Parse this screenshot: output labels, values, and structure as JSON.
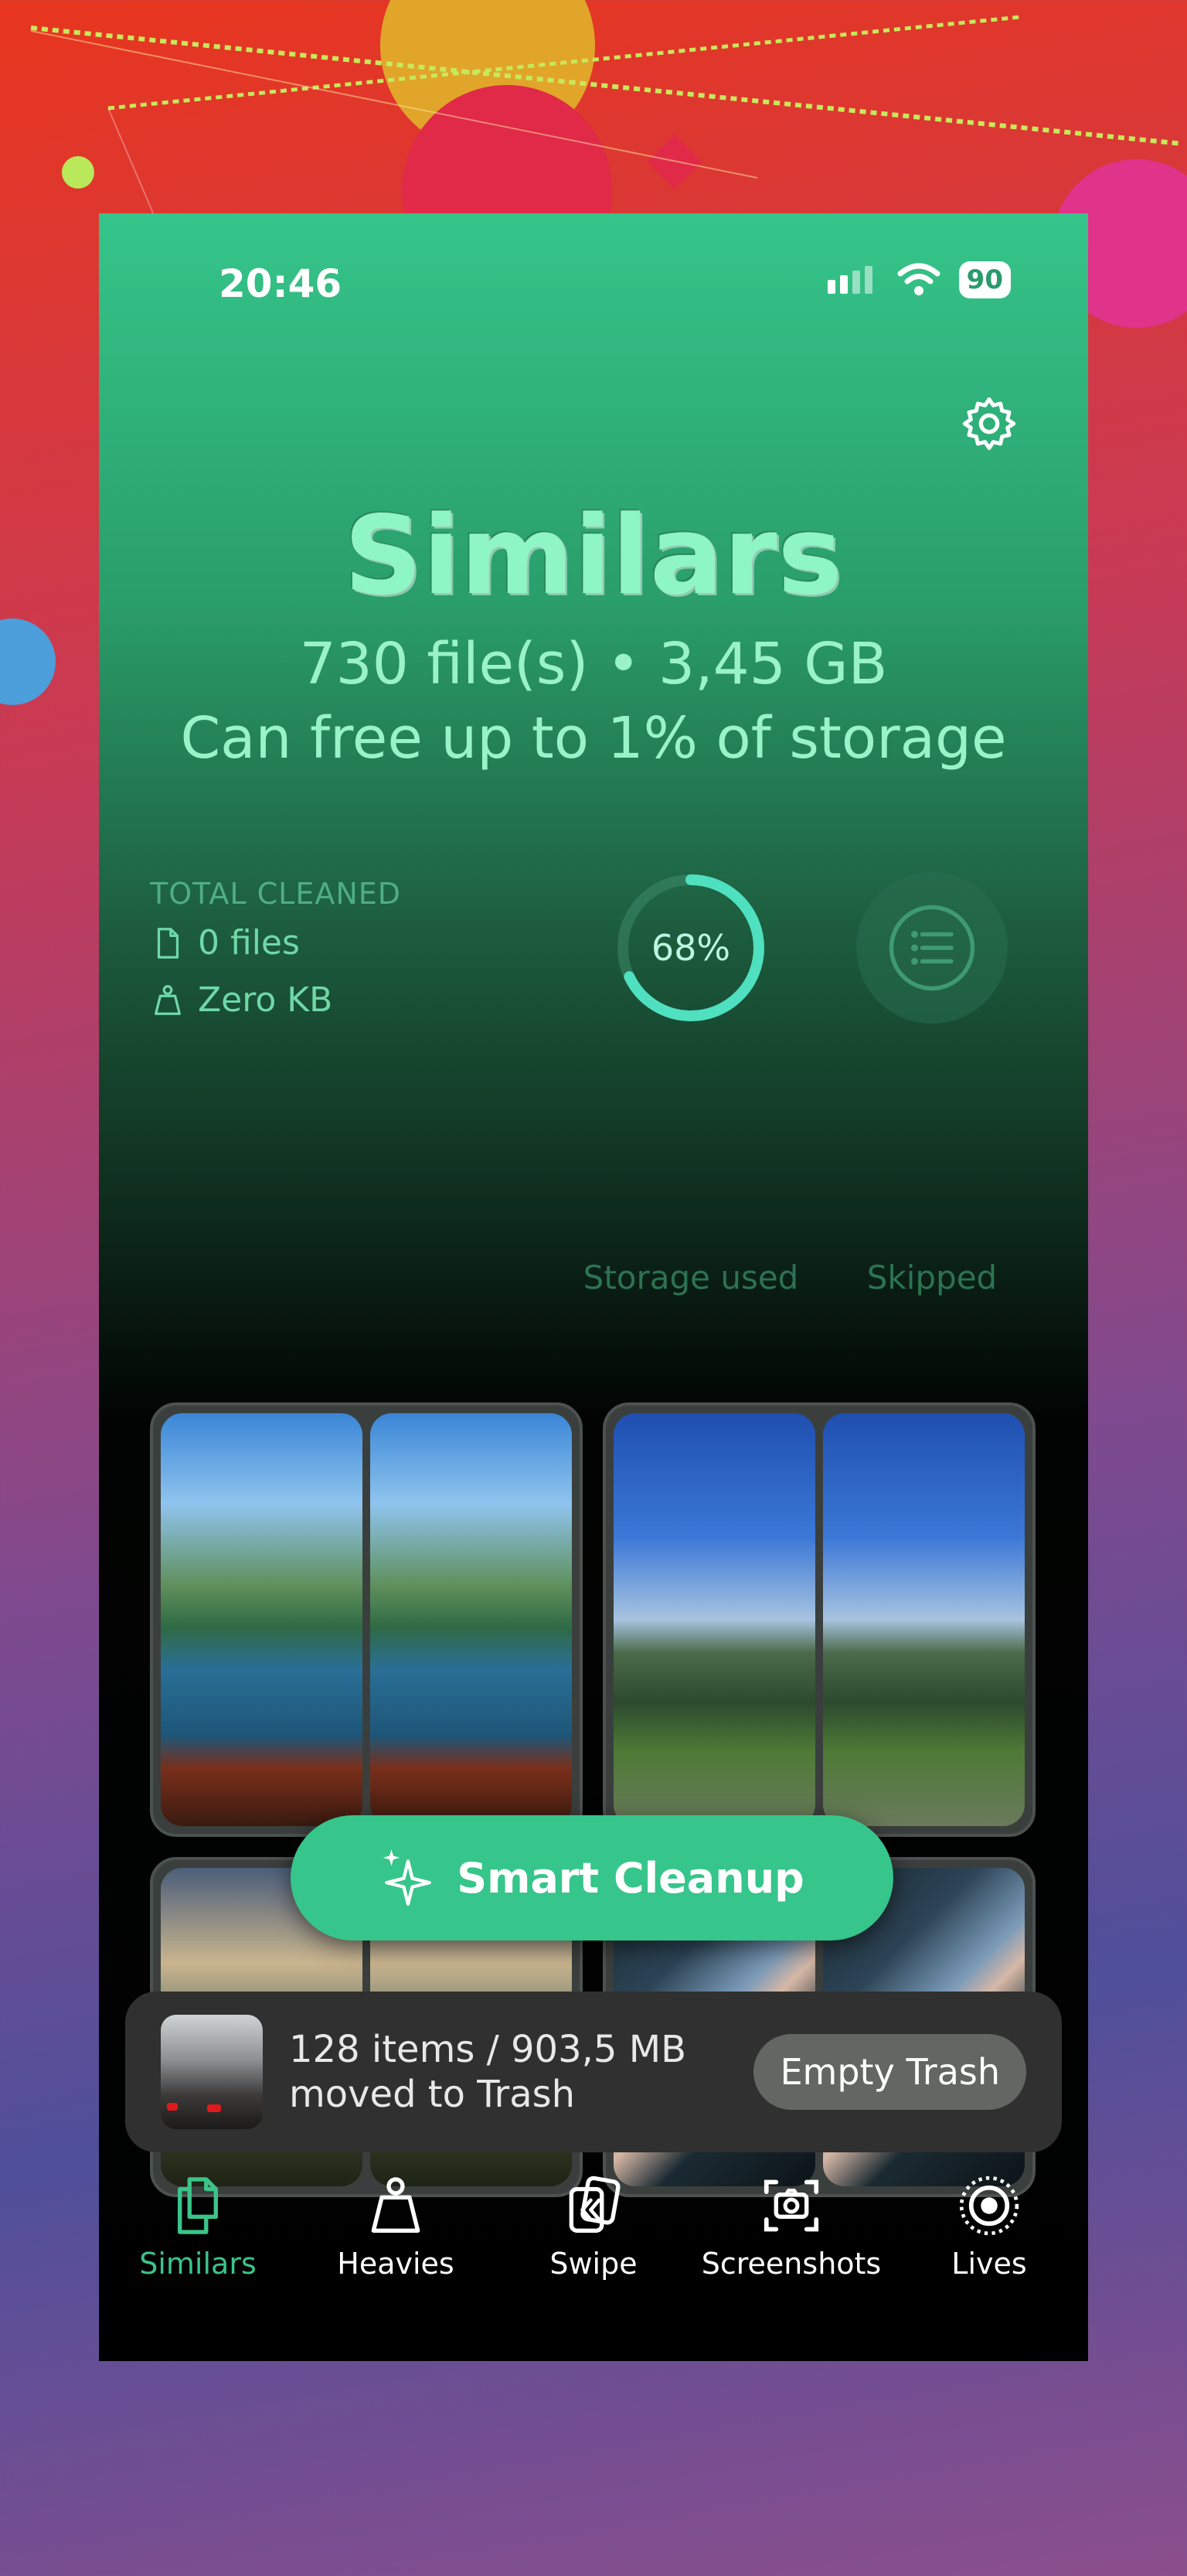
{
  "status": {
    "time": "20:46",
    "battery": "90"
  },
  "header": {
    "title": "Similars",
    "summary": "730 file(s) • 3,45 GB",
    "potential": "Can free up to 1% of storage"
  },
  "stats": {
    "total_label": "TOTAL CLEANED",
    "files": "0 files",
    "size": "Zero KB",
    "storage_percent": "68%",
    "storage_fraction": 0.68,
    "storage_caption": "Storage used",
    "skipped_caption": "Skipped"
  },
  "actions": {
    "smart_cleanup": "Smart Cleanup"
  },
  "trash_toast": {
    "line1": "128 items / 903,5 MB",
    "line2": "moved to Trash",
    "button": "Empty Trash"
  },
  "tabs": [
    {
      "label": "Similars",
      "icon": "similars-icon",
      "active": true
    },
    {
      "label": "Heavies",
      "icon": "weight-icon"
    },
    {
      "label": "Swipe",
      "icon": "swipe-icon"
    },
    {
      "label": "Screenshots",
      "icon": "screenshot-icon"
    },
    {
      "label": "Lives",
      "icon": "live-photo-icon"
    }
  ],
  "colors": {
    "accent": "#36c58a",
    "title": "#8ef5c4",
    "ring": "#4fe0c0"
  }
}
